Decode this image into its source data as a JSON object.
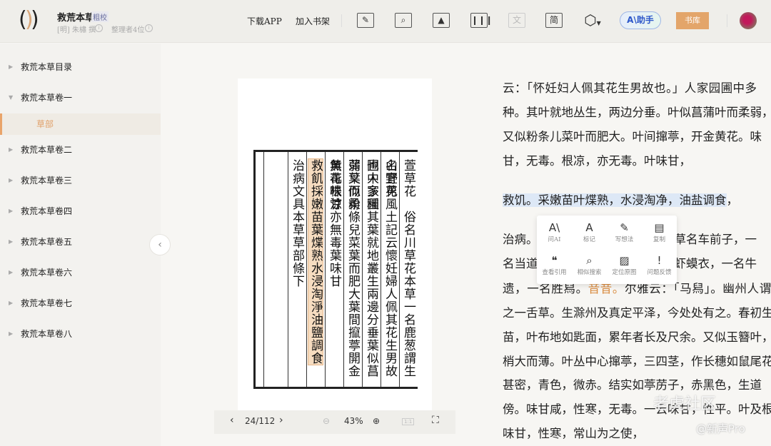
{
  "header": {
    "book_title": "救荒本草",
    "tag": "粗校",
    "author": "[明] 朱橚 撰",
    "editors": "整理者4位",
    "download": "下载APP",
    "add_shelf": "加入书架",
    "trad_simple": "简",
    "translate": "文",
    "ai_label": "A\\助手",
    "library": "书库"
  },
  "sidebar": {
    "items": [
      {
        "label": "救荒本草目录",
        "state": "collapsed"
      },
      {
        "label": "救荒本草卷一",
        "state": "expanded"
      },
      {
        "label": "草部",
        "state": "selected"
      },
      {
        "label": "救荒本草卷二"
      },
      {
        "label": "救荒本草卷三"
      },
      {
        "label": "救荒本草卷四"
      },
      {
        "label": "救荒本草卷五"
      },
      {
        "label": "救荒本草卷六"
      },
      {
        "label": "救荒本草卷七"
      },
      {
        "label": "救荒本草卷八"
      }
    ]
  },
  "scan": {
    "columns": [
      "萱草花　俗名川草花本草一名鹿葱謂生山野花",
      "名宜男風土記云懷妊婦人佩其花生男故也人家園",
      "圃中多種其葉就地叢生兩邊分垂葉似菖蒲葉而柔",
      "弱又似粉條兒菜葉而肥大葉間攛葶開金黄花味甘",
      "無毒根涼亦無毒葉味甘",
      "救飢採嫩苗葉煠熟水浸淘淨油鹽調食",
      "治病文具本草草部條下"
    ]
  },
  "page_toolbar": {
    "page": "24/112",
    "zoom": "43%",
    "actual_size": "1:1"
  },
  "text": {
    "lines": [
      "云：「怀妊妇人佩其花生男故也。」人家园圃中多",
      "种。其叶就地丛生，两边分垂。叶似菖蒲叶而柔弱，",
      "又似粉条儿菜叶而肥大。叶间撺葶，开金黄花。味",
      "甘，无毒。根凉，亦无毒。叶味甘，"
    ],
    "selected": "救饥。采嫩苗叶煠熟，水浸淘净，油盐调食",
    "selected_tail": "，",
    "occluded": [
      {
        "a": "治病。",
        "b": "草名车前子，一"
      },
      {
        "a": "名当道",
        "b": "虾蟆衣，一名牛"
      }
    ],
    "line_pre": "遗，一名胜舄。",
    "line_note": "音昔。",
    "line_post": "尔雅云：「马舄」。幽州人谓",
    "lines2": [
      "之一舌草。生滁州及真定平泽，今处处有之。春初生",
      "苗，叶布地如匙面，累年者长及尺余。又似玉簪叶，",
      "梢大而薄。叶丛中心撺葶，三四茎，作长穗如鼠尾花",
      "甚密，青色，微赤。结实如葶苈子，赤黑色，生道",
      "傍。味甘咸，性寒，无毒。一云味甘，性平。叶及根",
      "味甘，性寒，常山为之使，"
    ]
  },
  "popup": {
    "items": [
      {
        "label": "问AI",
        "icon": "A\\"
      },
      {
        "label": "标记",
        "icon": "A"
      },
      {
        "label": "写想法",
        "icon": "✎"
      },
      {
        "label": "复制",
        "icon": "▤"
      },
      {
        "label": "查看引用",
        "icon": "❝"
      },
      {
        "label": "相似搜索",
        "icon": "⌕"
      },
      {
        "label": "定位原图",
        "icon": "▨"
      },
      {
        "label": "问题反馈",
        "icon": "!"
      }
    ]
  },
  "watermark": {
    "line1": "老虎社区",
    "line2": "@新声Pro"
  }
}
